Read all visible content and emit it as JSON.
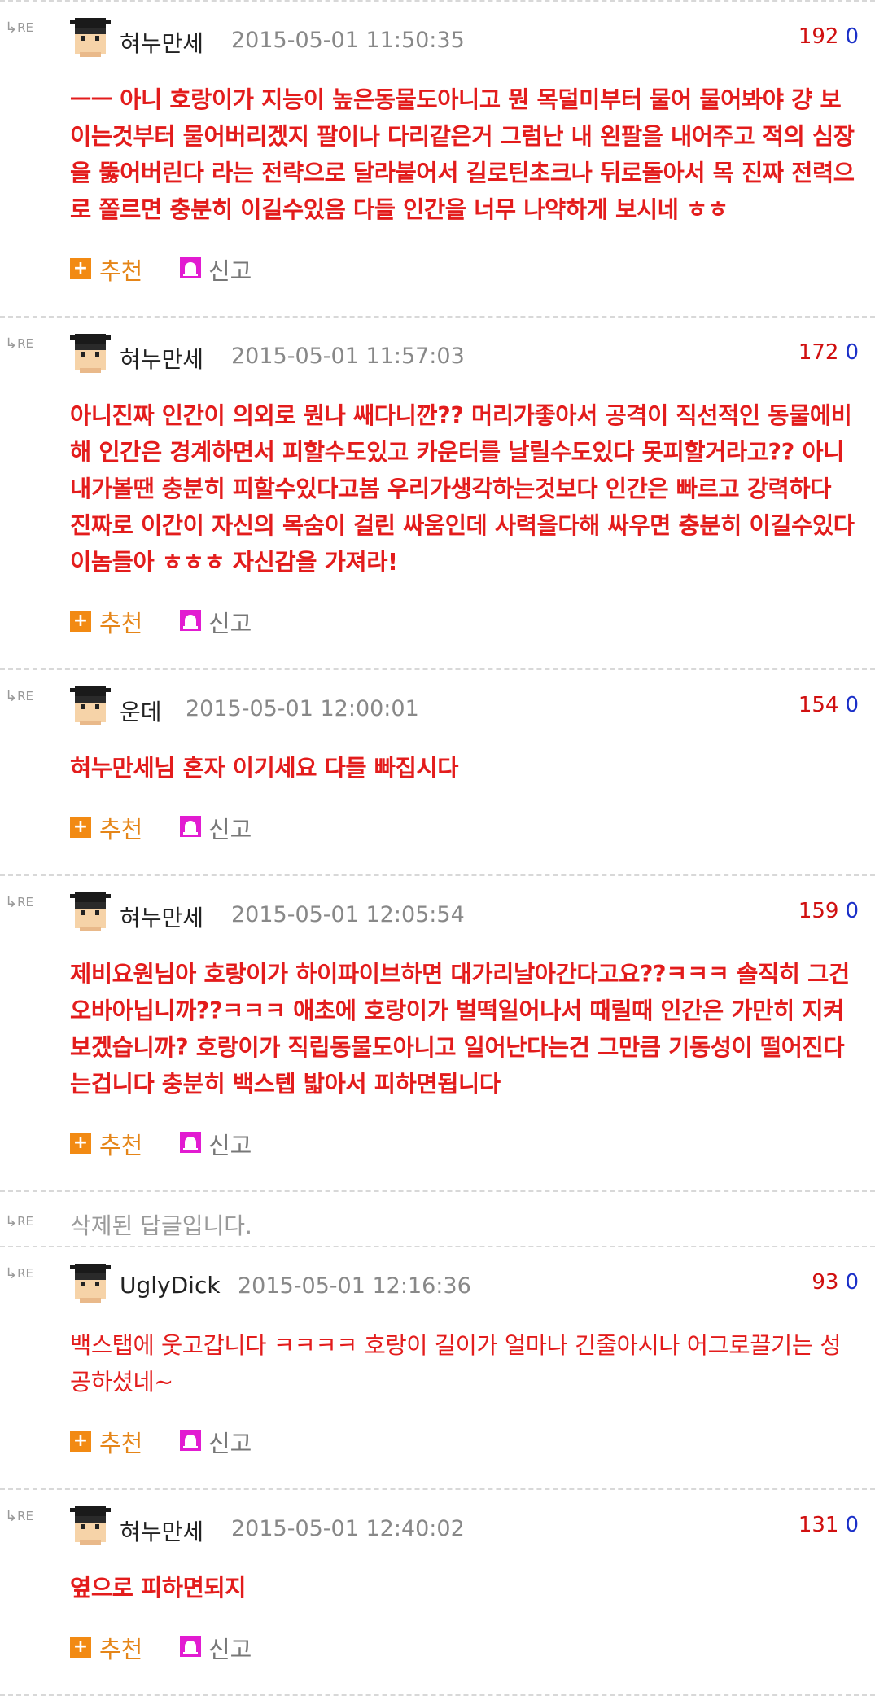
{
  "labels": {
    "re": "RE",
    "recommend": "추천",
    "report": "신고"
  },
  "colors": {
    "comment_text": "#e31c1c",
    "up_votes": "#d01010",
    "down_votes": "#1a2fc8",
    "recommend": "#e58518"
  },
  "comments": [
    {
      "nick": "혀누만세",
      "date": "2015-05-01 11:50:35",
      "up": "192",
      "down": "0",
      "text": "ㅡㅡ 아니 호랑이가 지능이 높은동물도아니고 뭔 목덜미부터 물어 물어봐야 걍 보이는것부터 물어버리겠지 팔이나 다리같은거 그럼난 내 왼팔을 내어주고 적의 심장을 뚫어버린다 라는 전략으로 달라붙어서 길로틴초크나 뒤로돌아서 목 진짜 전력으로 쫄르면 충분히 이길수있음 다들 인간을 너무 나약하게 보시네 ㅎㅎ"
    },
    {
      "nick": "혀누만세",
      "date": "2015-05-01 11:57:03",
      "up": "172",
      "down": "0",
      "text": "아니진짜 인간이 의외로 뭔나 쌔다니깐?? 머리가좋아서 공격이 직선적인 동물에비해 인간은 경계하면서 피할수도있고 카운터를 날릴수도있다 못피할거라고?? 아니 내가볼땐 충분히 피할수있다고봄 우리가생각하는것보다 인간은 빠르고 강력하다 진짜로 이간이 자신의 목숨이 걸린 싸움인데 사력을다해 싸우면 충분히 이길수있다 이놈들아 ㅎㅎㅎ 자신감을 가져라!"
    },
    {
      "nick": "운데",
      "date": "2015-05-01 12:00:01",
      "up": "154",
      "down": "0",
      "text": "혀누만세님 혼자 이기세요 다들 빠집시다"
    },
    {
      "nick": "혀누만세",
      "date": "2015-05-01 12:05:54",
      "up": "159",
      "down": "0",
      "text": "제비요원님아 호랑이가 하이파이브하면 대가리날아간다고요??ㅋㅋㅋ 솔직히 그건 오바아닙니까??ㅋㅋㅋ 애초에 호랑이가 벌떡일어나서 때릴때 인간은 가만히 지켜보겠습니까? 호랑이가 직립동물도아니고 일어난다는건 그만큼 기동성이 떨어진다는겁니다 충분히 백스텝 밟아서 피하면됩니다"
    },
    {
      "deleted": "삭제된 답글입니다."
    },
    {
      "nick": "UglyDick",
      "date": "2015-05-01 12:16:36",
      "up": "93",
      "down": "0",
      "text": "백스탭에 웃고갑니다 ㅋㅋㅋㅋ 호랑이 길이가 얼마나 긴줄아시나 어그로끌기는 성공하셨네~"
    },
    {
      "nick": "혀누만세",
      "date": "2015-05-01 12:40:02",
      "up": "131",
      "down": "0",
      "text": "옆으로 피하면되지"
    }
  ]
}
